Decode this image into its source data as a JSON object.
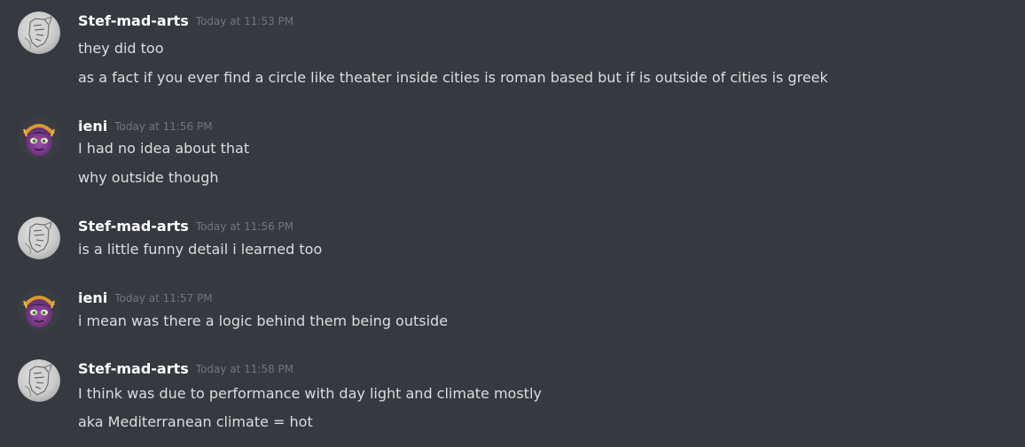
{
  "messages": [
    {
      "author": "Stef-mad-arts",
      "avatar": "stef-avatar",
      "timestamp": "Today at 11:53 PM",
      "lines": [
        "they did too",
        "as a fact if you ever find a circle like theater inside cities is roman based but if is outside of cities is greek"
      ]
    },
    {
      "author": "ieni",
      "avatar": "ieni-avatar",
      "timestamp": "Today at 11:56 PM",
      "lines": [
        "I had no idea about that",
        "why outside though"
      ]
    },
    {
      "author": "Stef-mad-arts",
      "avatar": "stef-avatar",
      "timestamp": "Today at 11:56 PM",
      "lines": [
        "is a little funny detail i learned too"
      ]
    },
    {
      "author": "ieni",
      "avatar": "ieni-avatar",
      "timestamp": "Today at 11:57 PM",
      "lines": [
        "i mean was there a logic behind them being outside"
      ]
    },
    {
      "author": "Stef-mad-arts",
      "avatar": "stef-avatar",
      "timestamp": "Today at 11:58 PM",
      "lines": [
        "I think was due to performance with day light and climate mostly",
        "aka Mediterranean climate = hot"
      ]
    }
  ],
  "colors": {
    "background": "#36393f",
    "username": "#ffffff",
    "message_text": "#dcddde",
    "timestamp": "#72767d"
  }
}
